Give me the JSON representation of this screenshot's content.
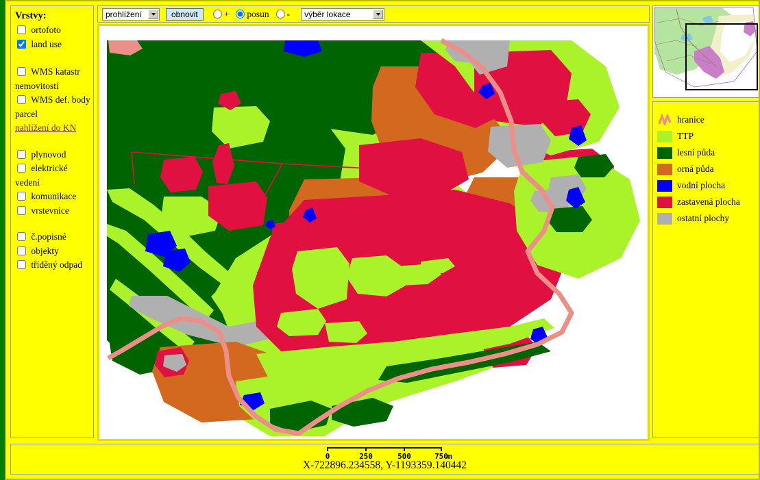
{
  "sidebar": {
    "title": "Vrstvy:",
    "items": [
      {
        "label": "ortofoto",
        "checked": false
      },
      {
        "label": "land use",
        "checked": true
      },
      {
        "label": "WMS katastr nemovitostí",
        "checked": false
      },
      {
        "label": "WMS def. body parcel",
        "checked": false
      },
      {
        "label": "plynovod",
        "checked": false
      },
      {
        "label": "elektrické vedení",
        "checked": false
      },
      {
        "label": "komunikace",
        "checked": false
      },
      {
        "label": "vrstevnice",
        "checked": false
      },
      {
        "label": "č.popisné",
        "checked": false
      },
      {
        "label": "objekty",
        "checked": false
      },
      {
        "label": "tříděný odpad",
        "checked": false
      }
    ],
    "kn_link": "nahlížení do KN "
  },
  "toolbar": {
    "mode_select": {
      "value": "prohlížení",
      "options": [
        "prohlížení"
      ]
    },
    "refresh_label": "obnovit",
    "radios": [
      {
        "label": "+",
        "selected": false
      },
      {
        "label": "posun",
        "selected": true
      },
      {
        "label": "-",
        "selected": false
      }
    ],
    "location_select": {
      "value": "výběr lokace",
      "options": [
        "výběr lokace"
      ]
    }
  },
  "legend": {
    "items": [
      {
        "label": "hranice",
        "color": "#ec8f88",
        "type": "line"
      },
      {
        "label": "TTP",
        "color": "#aaf22a",
        "type": "fill"
      },
      {
        "label": "lesní půda",
        "color": "#006400",
        "type": "fill"
      },
      {
        "label": "orná půda",
        "color": "#d2691e",
        "type": "fill"
      },
      {
        "label": "vodní plocha",
        "color": "#0000ff",
        "type": "fill"
      },
      {
        "label": "zastavená plocha",
        "color": "#e01040",
        "type": "fill"
      },
      {
        "label": "ostatní plochy",
        "color": "#b0b0b0",
        "type": "fill"
      }
    ]
  },
  "statusbar": {
    "scale": {
      "ticks": [
        "0",
        "250",
        "500",
        "750"
      ],
      "unit": "m"
    },
    "coordinates": "X-722896.234558, Y-1193359.140442"
  },
  "map": {
    "colors": {
      "background": "#ffffff",
      "boundary": "#ec8f88",
      "ttp": "#aaf22a",
      "forest": "#006400",
      "arable": "#d2691e",
      "water": "#0000ff",
      "builtup": "#e01040",
      "other": "#b0b0b0",
      "redline": "#e01040"
    }
  },
  "overview": {
    "colors": {
      "green": "#b5e3a0",
      "pale": "#f2f0c8",
      "violet": "#c87ec8",
      "white": "#ffffff",
      "extent_box": "#000000"
    }
  }
}
